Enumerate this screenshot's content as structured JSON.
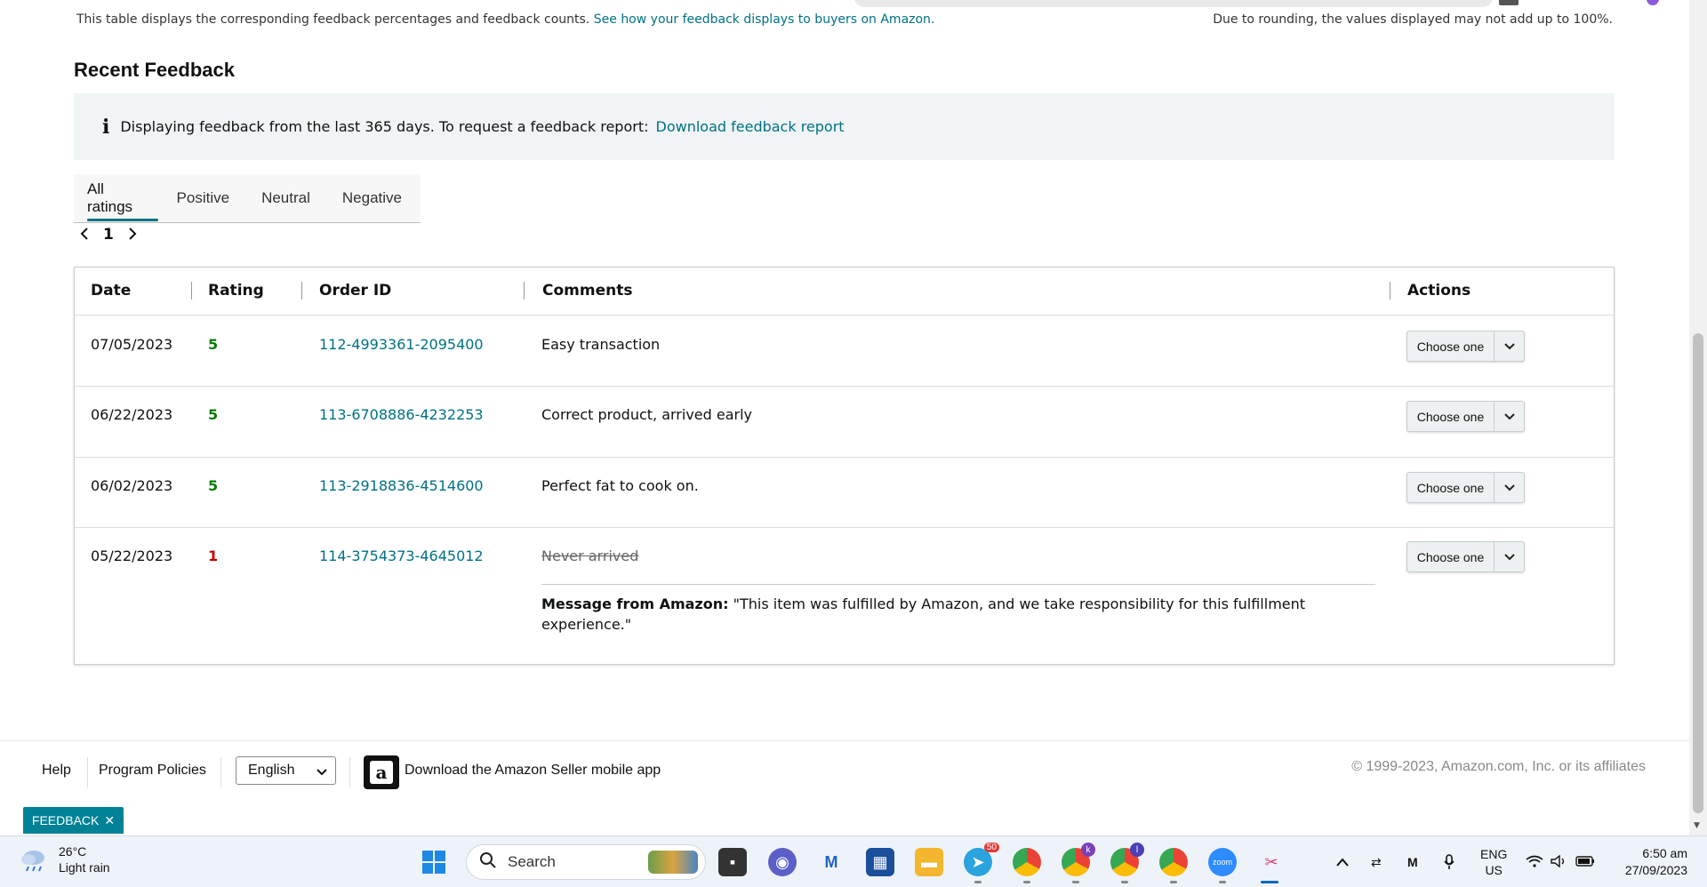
{
  "page": {
    "table_note": "This table displays the corresponding feedback percentages and feedback counts.",
    "table_note_link": "See how your feedback displays to buyers on Amazon.",
    "rounding_note": "Due to rounding, the values displayed may not add up to 100%.",
    "section_title": "Recent Feedback",
    "info_text": "Displaying feedback from the last 365 days. To request a feedback report:",
    "info_link": "Download feedback report",
    "info_icon": "i"
  },
  "tabs": [
    {
      "label": "All ratings",
      "active": true
    },
    {
      "label": "Positive",
      "active": false
    },
    {
      "label": "Neutral",
      "active": false
    },
    {
      "label": "Negative",
      "active": false
    }
  ],
  "pager": {
    "current_page": "1",
    "prev": "‹",
    "next": "›"
  },
  "table": {
    "headers": {
      "date": "Date",
      "rating": "Rating",
      "order_id": "Order ID",
      "comments": "Comments",
      "actions": "Actions"
    },
    "rows": [
      {
        "date": "07/05/2023",
        "rating": "5",
        "order_id": "112-4993361-2095400",
        "comment": "Easy transaction",
        "action": "Choose one"
      },
      {
        "date": "06/22/2023",
        "rating": "5",
        "order_id": "113-6708886-4232253",
        "comment": "Correct product, arrived early",
        "action": "Choose one"
      },
      {
        "date": "06/02/2023",
        "rating": "5",
        "order_id": "113-2918836-4514600",
        "comment": "Perfect fat to cook on.",
        "action": "Choose one"
      },
      {
        "date": "05/22/2023",
        "rating": "1",
        "order_id": "114-3754373-4645012",
        "comment": "Never arrived",
        "action": "Choose one",
        "amazon_message_label": "Message from Amazon:",
        "amazon_message": "\"This item was fulfilled by Amazon, and we take responsibility for this fulfillment experience.\""
      }
    ]
  },
  "colors": {
    "link": "#007185",
    "positive": "#067d06",
    "negative": "#c40000",
    "feedback_tab": "#008296"
  },
  "footer": {
    "help": "Help",
    "program_policies": "Program Policies",
    "language": "English",
    "app_promo": "Download the Amazon Seller mobile app",
    "app_logo_letter": "a",
    "copyright": "© 1999-2023, Amazon.com, Inc. or its affiliates"
  },
  "feedback_tab": {
    "label": "FEEDBACK",
    "close": "✕"
  },
  "taskbar": {
    "temperature": "26°C",
    "weather": "Light rain",
    "search_placeholder": "Search",
    "telegram_badge": "50",
    "lang_line1": "ENG",
    "lang_line2": "US",
    "time": "6:50 am",
    "date": "27/09/2023",
    "profile_letters": [
      "k",
      "l"
    ]
  }
}
